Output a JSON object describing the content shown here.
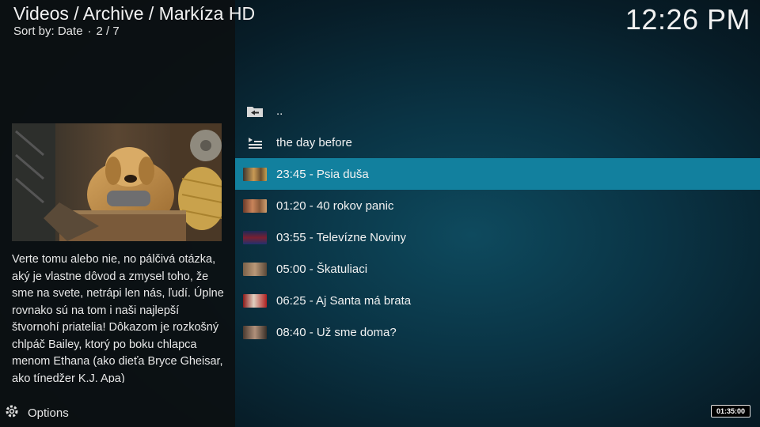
{
  "header": {
    "title": "Videos / Archive / Markíza HD",
    "sort_label": "Sort by: Date",
    "separator": "·",
    "position": "2 / 7"
  },
  "clock": "12:26 PM",
  "plot": "Verte tomu alebo nie, no pálčivá otázka, aký je vlastne dôvod a zmysel toho, že sme na svete, netrápi len nás, ľudí. Úplne rovnako sú na tom i naši najlepší štvornohí priatelia! Dôkazom je rozkošný chlpáč Bailey, ktorý po boku chlapca menom Ethana (ako dieťa Bryce Gheisar, ako tínedžer K.J. Apa)",
  "list": {
    "items": [
      {
        "label": "..",
        "icon": "folder-back-icon"
      },
      {
        "label": "the day before",
        "icon": "playlist-icon"
      },
      {
        "label": "23:45 - Psia duša",
        "icon": "thumbnail-icon",
        "selected": true
      },
      {
        "label": "01:20 - 40 rokov panic",
        "icon": "thumbnail-icon"
      },
      {
        "label": "03:55 - Televízne Noviny",
        "icon": "thumbnail-icon"
      },
      {
        "label": "05:00 - Škatuliaci",
        "icon": "thumbnail-icon"
      },
      {
        "label": "06:25 - Aj Santa má brata",
        "icon": "thumbnail-icon"
      },
      {
        "label": "08:40 - Už sme doma?",
        "icon": "thumbnail-icon"
      }
    ]
  },
  "options_label": "Options",
  "duration_badge": "01:35:00",
  "colors": {
    "selection": "#12809e",
    "panel": "#0c1012"
  }
}
